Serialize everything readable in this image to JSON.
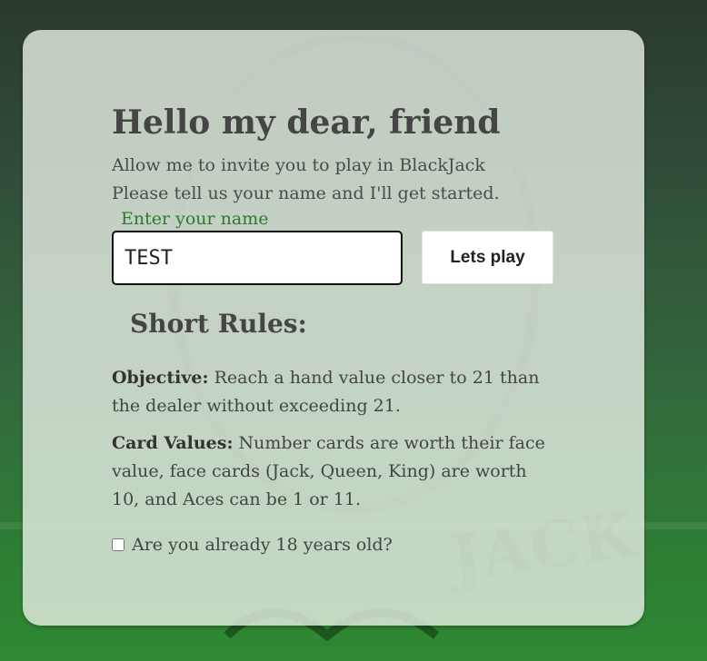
{
  "colors": {
    "accent_label": "#2e7a2e",
    "card_bg": "#e4ece2",
    "background_top": "#2a3a2c",
    "background_bottom": "#2e8a33"
  },
  "greeting": {
    "title": "Hello my dear, friend",
    "line1": "Allow me to invite you to play in BlackJack",
    "line2": "Please tell us your name and I'll get started."
  },
  "name_form": {
    "label": "Enter your name",
    "value": "TEST",
    "button_label": "Lets play"
  },
  "rules": {
    "title": "Short Rules:",
    "objective_label": "Objective:",
    "objective_text": "Reach a hand value closer to 21 than the dealer without exceeding 21.",
    "card_values_label": "Card Values:",
    "card_values_text": "Number cards are worth their face value, face cards (Jack, Queen, King) are worth 10, and Aces can be 1 or 11."
  },
  "age_check": {
    "label": "Are you already 18 years old?",
    "checked": false
  }
}
